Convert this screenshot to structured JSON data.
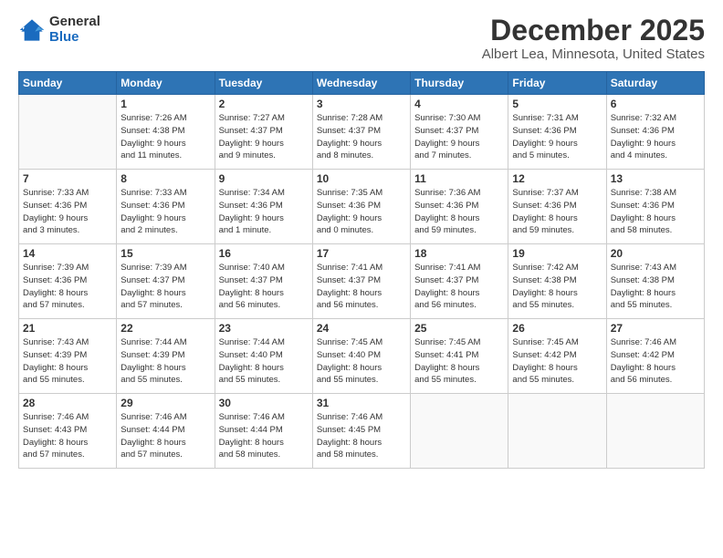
{
  "logo": {
    "general": "General",
    "blue": "Blue"
  },
  "header": {
    "title": "December 2025",
    "subtitle": "Albert Lea, Minnesota, United States"
  },
  "weekdays": [
    "Sunday",
    "Monday",
    "Tuesday",
    "Wednesday",
    "Thursday",
    "Friday",
    "Saturday"
  ],
  "weeks": [
    [
      {
        "day": "",
        "info": ""
      },
      {
        "day": "1",
        "info": "Sunrise: 7:26 AM\nSunset: 4:38 PM\nDaylight: 9 hours\nand 11 minutes."
      },
      {
        "day": "2",
        "info": "Sunrise: 7:27 AM\nSunset: 4:37 PM\nDaylight: 9 hours\nand 9 minutes."
      },
      {
        "day": "3",
        "info": "Sunrise: 7:28 AM\nSunset: 4:37 PM\nDaylight: 9 hours\nand 8 minutes."
      },
      {
        "day": "4",
        "info": "Sunrise: 7:30 AM\nSunset: 4:37 PM\nDaylight: 9 hours\nand 7 minutes."
      },
      {
        "day": "5",
        "info": "Sunrise: 7:31 AM\nSunset: 4:36 PM\nDaylight: 9 hours\nand 5 minutes."
      },
      {
        "day": "6",
        "info": "Sunrise: 7:32 AM\nSunset: 4:36 PM\nDaylight: 9 hours\nand 4 minutes."
      }
    ],
    [
      {
        "day": "7",
        "info": "Sunrise: 7:33 AM\nSunset: 4:36 PM\nDaylight: 9 hours\nand 3 minutes."
      },
      {
        "day": "8",
        "info": "Sunrise: 7:33 AM\nSunset: 4:36 PM\nDaylight: 9 hours\nand 2 minutes."
      },
      {
        "day": "9",
        "info": "Sunrise: 7:34 AM\nSunset: 4:36 PM\nDaylight: 9 hours\nand 1 minute."
      },
      {
        "day": "10",
        "info": "Sunrise: 7:35 AM\nSunset: 4:36 PM\nDaylight: 9 hours\nand 0 minutes."
      },
      {
        "day": "11",
        "info": "Sunrise: 7:36 AM\nSunset: 4:36 PM\nDaylight: 8 hours\nand 59 minutes."
      },
      {
        "day": "12",
        "info": "Sunrise: 7:37 AM\nSunset: 4:36 PM\nDaylight: 8 hours\nand 59 minutes."
      },
      {
        "day": "13",
        "info": "Sunrise: 7:38 AM\nSunset: 4:36 PM\nDaylight: 8 hours\nand 58 minutes."
      }
    ],
    [
      {
        "day": "14",
        "info": "Sunrise: 7:39 AM\nSunset: 4:36 PM\nDaylight: 8 hours\nand 57 minutes."
      },
      {
        "day": "15",
        "info": "Sunrise: 7:39 AM\nSunset: 4:37 PM\nDaylight: 8 hours\nand 57 minutes."
      },
      {
        "day": "16",
        "info": "Sunrise: 7:40 AM\nSunset: 4:37 PM\nDaylight: 8 hours\nand 56 minutes."
      },
      {
        "day": "17",
        "info": "Sunrise: 7:41 AM\nSunset: 4:37 PM\nDaylight: 8 hours\nand 56 minutes."
      },
      {
        "day": "18",
        "info": "Sunrise: 7:41 AM\nSunset: 4:37 PM\nDaylight: 8 hours\nand 56 minutes."
      },
      {
        "day": "19",
        "info": "Sunrise: 7:42 AM\nSunset: 4:38 PM\nDaylight: 8 hours\nand 55 minutes."
      },
      {
        "day": "20",
        "info": "Sunrise: 7:43 AM\nSunset: 4:38 PM\nDaylight: 8 hours\nand 55 minutes."
      }
    ],
    [
      {
        "day": "21",
        "info": "Sunrise: 7:43 AM\nSunset: 4:39 PM\nDaylight: 8 hours\nand 55 minutes."
      },
      {
        "day": "22",
        "info": "Sunrise: 7:44 AM\nSunset: 4:39 PM\nDaylight: 8 hours\nand 55 minutes."
      },
      {
        "day": "23",
        "info": "Sunrise: 7:44 AM\nSunset: 4:40 PM\nDaylight: 8 hours\nand 55 minutes."
      },
      {
        "day": "24",
        "info": "Sunrise: 7:45 AM\nSunset: 4:40 PM\nDaylight: 8 hours\nand 55 minutes."
      },
      {
        "day": "25",
        "info": "Sunrise: 7:45 AM\nSunset: 4:41 PM\nDaylight: 8 hours\nand 55 minutes."
      },
      {
        "day": "26",
        "info": "Sunrise: 7:45 AM\nSunset: 4:42 PM\nDaylight: 8 hours\nand 55 minutes."
      },
      {
        "day": "27",
        "info": "Sunrise: 7:46 AM\nSunset: 4:42 PM\nDaylight: 8 hours\nand 56 minutes."
      }
    ],
    [
      {
        "day": "28",
        "info": "Sunrise: 7:46 AM\nSunset: 4:43 PM\nDaylight: 8 hours\nand 57 minutes."
      },
      {
        "day": "29",
        "info": "Sunrise: 7:46 AM\nSunset: 4:44 PM\nDaylight: 8 hours\nand 57 minutes."
      },
      {
        "day": "30",
        "info": "Sunrise: 7:46 AM\nSunset: 4:44 PM\nDaylight: 8 hours\nand 58 minutes."
      },
      {
        "day": "31",
        "info": "Sunrise: 7:46 AM\nSunset: 4:45 PM\nDaylight: 8 hours\nand 58 minutes."
      },
      {
        "day": "",
        "info": ""
      },
      {
        "day": "",
        "info": ""
      },
      {
        "day": "",
        "info": ""
      }
    ]
  ]
}
